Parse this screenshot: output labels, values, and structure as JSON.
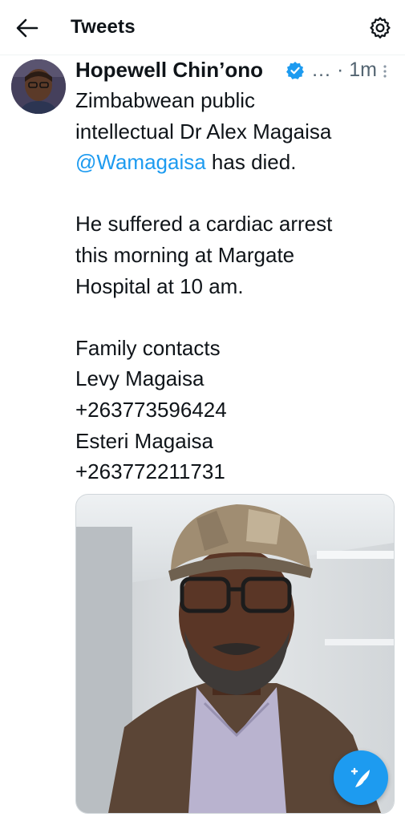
{
  "header": {
    "title": "Tweets",
    "back_icon": "arrow-left-icon",
    "settings_icon": "gear-icon"
  },
  "tweet": {
    "author_name": "Hopewell Chin’ono",
    "verified_icon": "verified-badge-icon",
    "meta": "… · 1m",
    "lines": {
      "l1": "Zimbabwean public",
      "l2": "intellectual Dr Alex Magaisa",
      "mention": "@Wamagaisa",
      "l3_suffix": " has died.",
      "l4": "He suffered a cardiac arrest",
      "l5": "this morning at Margate",
      "l6": "Hospital at 10 am.",
      "l7": "Family contacts",
      "l8": "Levy Magaisa",
      "l9": "+263773596424",
      "l10": "Esteri Magaisa",
      "l11": "+263772211731"
    }
  },
  "fab": {
    "icon": "compose-tweet-icon"
  },
  "colors": {
    "accent": "#1d9bf0",
    "text": "#0f1419",
    "muted": "#536471"
  }
}
